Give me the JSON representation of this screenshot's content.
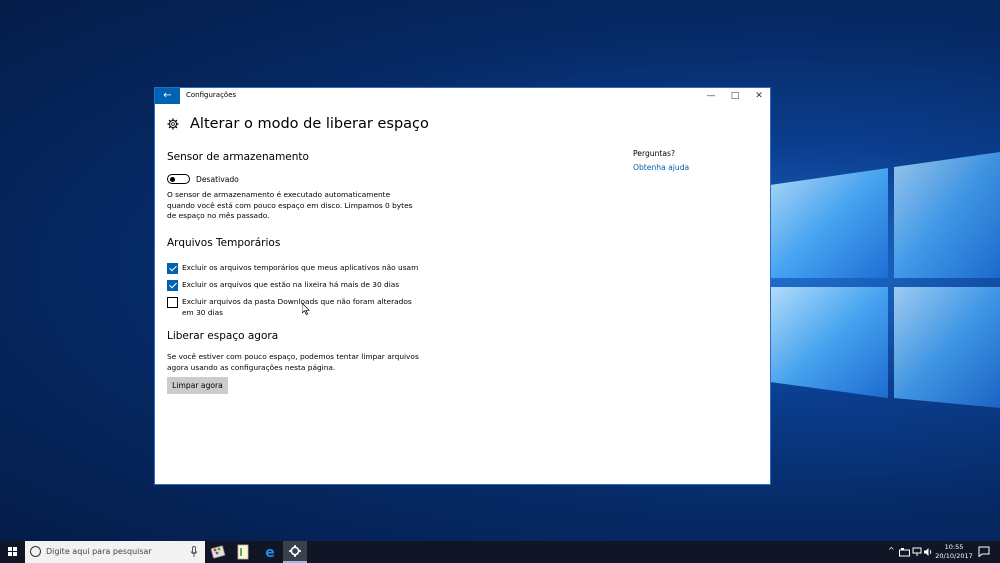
{
  "window": {
    "title": "Configurações",
    "back_icon": "arrow-left-icon",
    "minimize": "—",
    "maximize": "□",
    "close": "✕"
  },
  "page": {
    "title": "Alterar o modo de liberar espaço"
  },
  "storage_sense": {
    "heading": "Sensor de armazenamento",
    "toggle_label": "Desativado",
    "description_lines": [
      "O sensor de armazenamento é executado automaticamente",
      "quando você está com pouco espaço em disco. Limpamos 0 bytes",
      "de espaço no mês passado."
    ]
  },
  "temp_files": {
    "heading": "Arquivos Temporários",
    "options": [
      {
        "lines": [
          "Excluir os arquivos temporários que meus aplicativos não usam"
        ],
        "checked": true
      },
      {
        "lines": [
          "Excluir os arquivos que estão na lixeira há mais de 30 dias"
        ],
        "checked": true
      },
      {
        "lines": [
          "Excluir arquivos da pasta Downloads que não foram alterados",
          "em 30 dias"
        ],
        "checked": false
      }
    ]
  },
  "free_now": {
    "heading": "Liberar espaço agora",
    "description_lines": [
      "Se você estiver com pouco espaço, podemos tentar limpar arquivos",
      "agora usando as configurações nesta página."
    ],
    "button_label": "Limpar agora"
  },
  "sidebar": {
    "question": "Perguntas?",
    "help_link": "Obtenha ajuda"
  },
  "taskbar": {
    "search_placeholder": "Digite aqui para pesquisar",
    "time": "10:55",
    "date": "20/10/2017",
    "tray_chevron": "^"
  },
  "colors": {
    "accent": "#0063b1",
    "taskbar": "#101626",
    "button": "#cccccc"
  }
}
